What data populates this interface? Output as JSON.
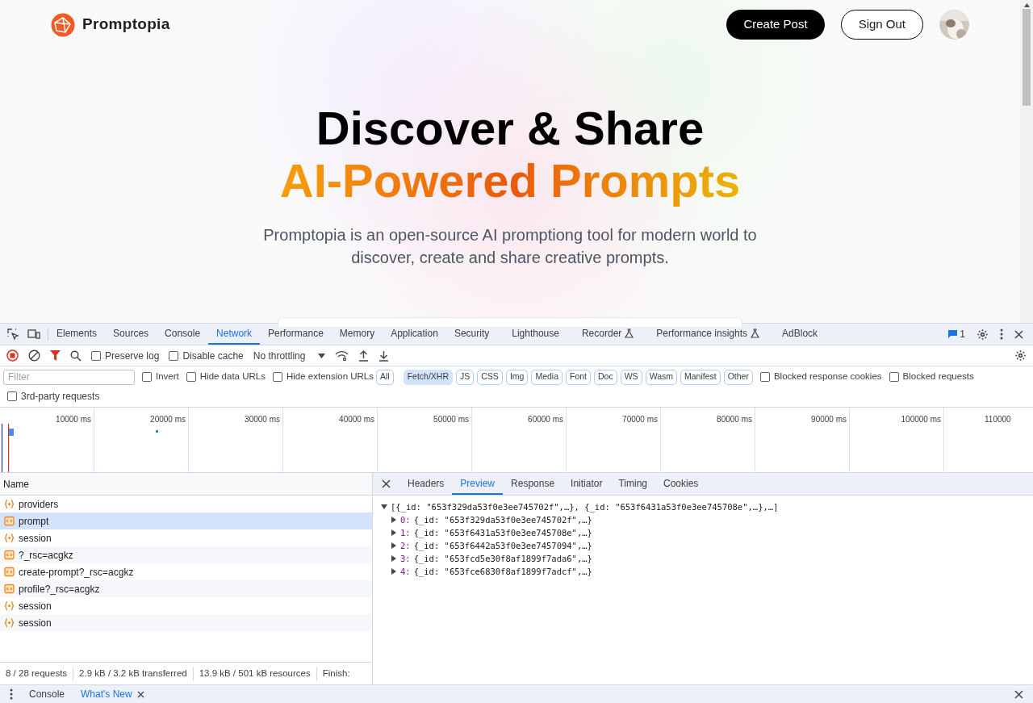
{
  "nav": {
    "brand": "Promptopia",
    "create_button": "Create Post",
    "signout_button": "Sign Out"
  },
  "hero": {
    "title": "Discover & Share",
    "highlight": "AI-Powered Prompts",
    "description": "Promptopia is an open-source AI promptiong tool for modern world to discover, create and share creative prompts."
  },
  "devtools": {
    "tabs": [
      {
        "label": "Elements",
        "selected": false,
        "experimental": false
      },
      {
        "label": "Sources",
        "selected": false,
        "experimental": false
      },
      {
        "label": "Console",
        "selected": false,
        "experimental": false
      },
      {
        "label": "Network",
        "selected": true,
        "experimental": false
      },
      {
        "label": "Performance",
        "selected": false,
        "experimental": false
      },
      {
        "label": "Memory",
        "selected": false,
        "experimental": false
      },
      {
        "label": "Application",
        "selected": false,
        "experimental": false
      },
      {
        "label": "Security",
        "selected": false,
        "experimental": false
      },
      {
        "label": "Lighthouse",
        "selected": false,
        "experimental": false
      },
      {
        "label": "Recorder",
        "selected": false,
        "experimental": true
      },
      {
        "label": "Performance insights",
        "selected": false,
        "experimental": true
      },
      {
        "label": "AdBlock",
        "selected": false,
        "experimental": false
      }
    ],
    "issues_count": "1",
    "toolbar_checks": [
      {
        "label": "Preserve log",
        "checked": false
      },
      {
        "label": "Disable cache",
        "checked": false
      }
    ],
    "throttling": "No throttling",
    "filter": {
      "placeholder": "Filter"
    },
    "filter_checks": [
      {
        "label": "Invert",
        "checked": false
      },
      {
        "label": "Hide data URLs",
        "checked": false
      },
      {
        "label": "Hide extension URLs",
        "checked": false
      }
    ],
    "type_filters": [
      {
        "label": "All",
        "selected": false
      },
      {
        "label": "Fetch/XHR",
        "selected": true
      },
      {
        "label": "JS",
        "selected": false
      },
      {
        "label": "CSS",
        "selected": false
      },
      {
        "label": "Img",
        "selected": false
      },
      {
        "label": "Media",
        "selected": false
      },
      {
        "label": "Font",
        "selected": false
      },
      {
        "label": "Doc",
        "selected": false
      },
      {
        "label": "WS",
        "selected": false
      },
      {
        "label": "Wasm",
        "selected": false
      },
      {
        "label": "Manifest",
        "selected": false
      },
      {
        "label": "Other",
        "selected": false
      }
    ],
    "blocked_checks": [
      {
        "label": "Blocked response cookies",
        "checked": false
      },
      {
        "label": "Blocked requests",
        "checked": false
      }
    ],
    "third_party": {
      "label": "3rd-party requests",
      "checked": false
    },
    "timeline_ticks": [
      "10000 ms",
      "20000 ms",
      "30000 ms",
      "40000 ms",
      "50000 ms",
      "60000 ms",
      "70000 ms",
      "80000 ms",
      "90000 ms",
      "100000 ms",
      "110000"
    ],
    "name_header": "Name",
    "requests": [
      {
        "name": "providers",
        "kind": "json",
        "selected": false
      },
      {
        "name": "prompt",
        "kind": "doc",
        "selected": true
      },
      {
        "name": "session",
        "kind": "json",
        "selected": false
      },
      {
        "name": "?_rsc=acgkz",
        "kind": "doc",
        "selected": false
      },
      {
        "name": "create-prompt?_rsc=acgkz",
        "kind": "doc",
        "selected": false
      },
      {
        "name": "profile?_rsc=acgkz",
        "kind": "doc",
        "selected": false
      },
      {
        "name": "session",
        "kind": "json",
        "selected": false
      },
      {
        "name": "session",
        "kind": "json",
        "selected": false
      }
    ],
    "detail_tabs": [
      {
        "label": "Headers",
        "selected": false
      },
      {
        "label": "Preview",
        "selected": true
      },
      {
        "label": "Response",
        "selected": false
      },
      {
        "label": "Initiator",
        "selected": false
      },
      {
        "label": "Timing",
        "selected": false
      },
      {
        "label": "Cookies",
        "selected": false
      }
    ],
    "preview": {
      "summary": "[{_id: \"653f329da53f0e3ee745702f\",…}, {_id: \"653f6431a53f0e3ee745708e\",…},…]",
      "expanded": true,
      "children": [
        {
          "index": "0:",
          "value": "{_id: \"653f329da53f0e3ee745702f\",…}",
          "expanded": false
        },
        {
          "index": "1:",
          "value": "{_id: \"653f6431a53f0e3ee745708e\",…}",
          "expanded": false
        },
        {
          "index": "2:",
          "value": "{_id: \"653f6442a53f0e3ee7457094\",…}",
          "expanded": false
        },
        {
          "index": "3:",
          "value": "{_id: \"653fcd5e30f8af1899f7ada6\",…}",
          "expanded": false
        },
        {
          "index": "4:",
          "value": "{_id: \"653fce6830f8af1899f7adcf\",…}",
          "expanded": false
        }
      ]
    },
    "status": [
      "8 / 28 requests",
      "2.9 kB / 3.2 kB transferred",
      "13.9 kB / 501 kB resources",
      "Finish:"
    ],
    "drawer_tabs": [
      {
        "label": "Console",
        "selected": false,
        "closable": false
      },
      {
        "label": "What's New",
        "selected": true,
        "closable": true
      }
    ]
  }
}
